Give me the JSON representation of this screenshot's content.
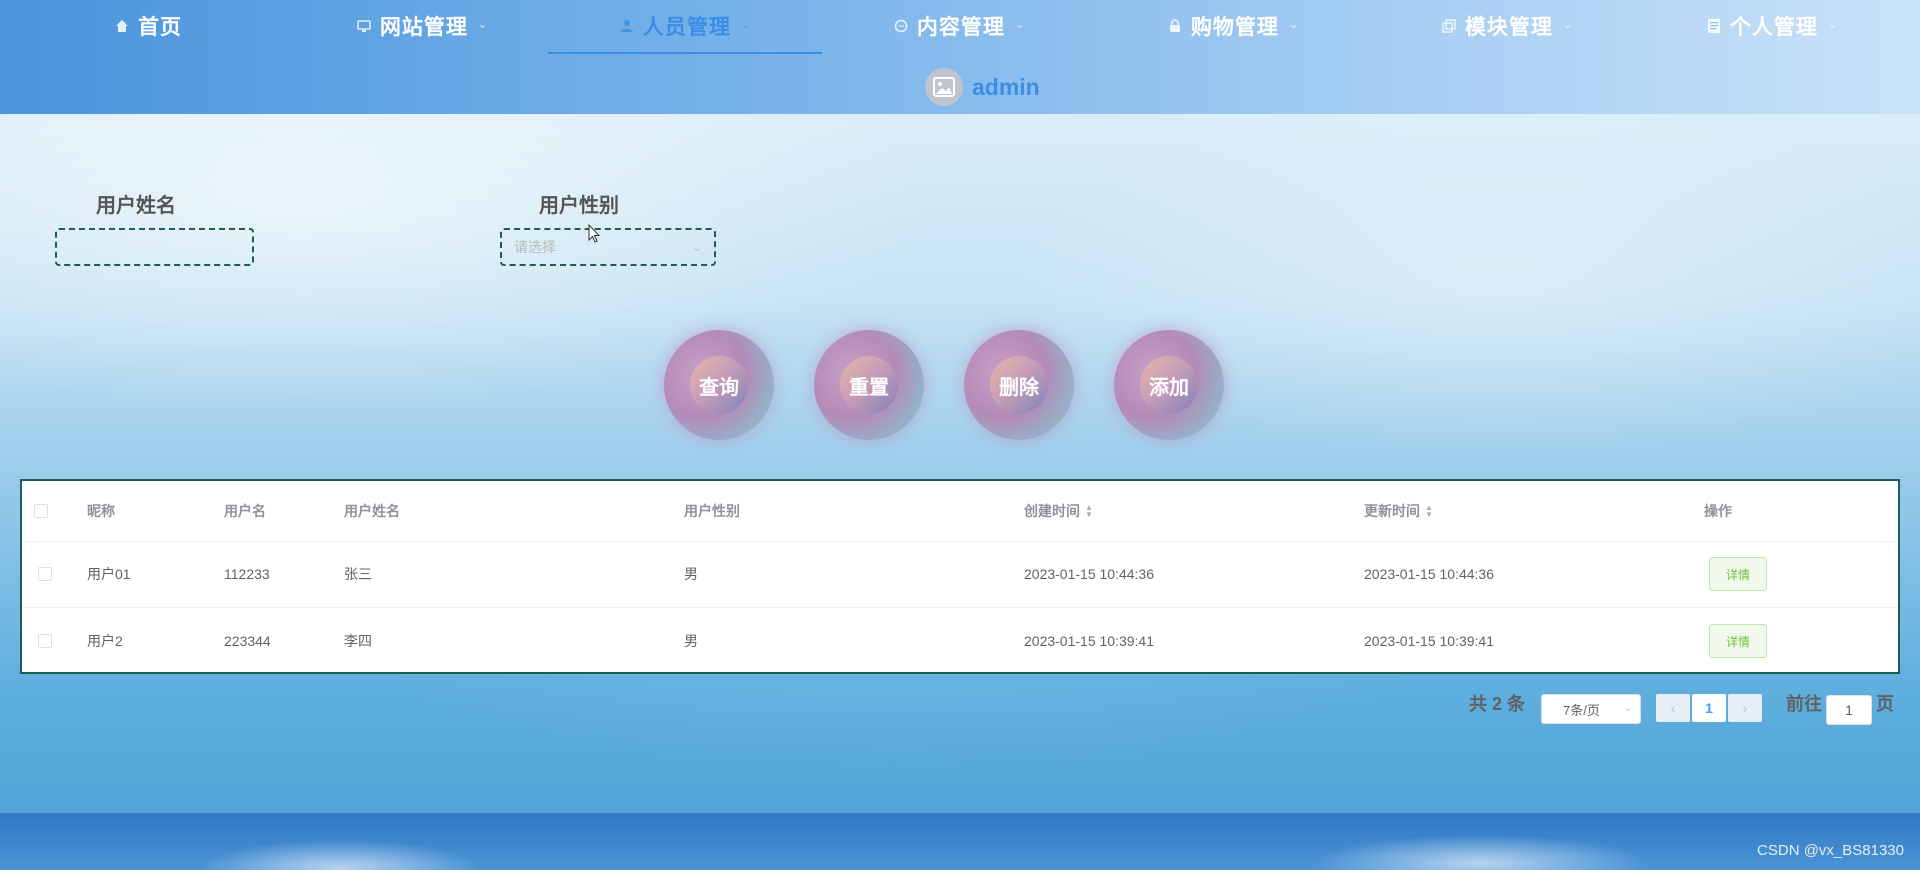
{
  "nav": {
    "items": [
      {
        "label": "首页",
        "icon": "home-icon",
        "active": false,
        "dropdown": false
      },
      {
        "label": "网站管理",
        "icon": "monitor-icon",
        "active": false,
        "dropdown": true
      },
      {
        "label": "人员管理",
        "icon": "user-icon",
        "active": true,
        "dropdown": true
      },
      {
        "label": "内容管理",
        "icon": "chat-icon",
        "active": false,
        "dropdown": true
      },
      {
        "label": "购物管理",
        "icon": "lock-icon",
        "active": false,
        "dropdown": true
      },
      {
        "label": "模块管理",
        "icon": "copy-icon",
        "active": false,
        "dropdown": true
      },
      {
        "label": "个人管理",
        "icon": "document-icon",
        "active": false,
        "dropdown": true
      }
    ],
    "username": "admin"
  },
  "search": {
    "name_label": "用户姓名",
    "name_value": "",
    "gender_label": "用户性别",
    "gender_placeholder": "请选择"
  },
  "actions": {
    "query": "查询",
    "reset": "重置",
    "delete": "删除",
    "add": "添加"
  },
  "table": {
    "columns": [
      "昵称",
      "用户名",
      "用户姓名",
      "用户性别",
      "创建时间",
      "更新时间",
      "操作"
    ],
    "rows": [
      {
        "nickname": "用户01",
        "username": "112233",
        "realname": "张三",
        "gender": "男",
        "created": "2023-01-15 10:44:36",
        "updated": "2023-01-15 10:44:36",
        "action": "详情"
      },
      {
        "nickname": "用户2",
        "username": "223344",
        "realname": "李四",
        "gender": "男",
        "created": "2023-01-15 10:39:41",
        "updated": "2023-01-15 10:39:41",
        "action": "详情"
      }
    ]
  },
  "pagination": {
    "total_text": "共 2 条",
    "page_size": "7条/页",
    "current_page": "1",
    "goto_prefix": "前往",
    "goto_value": "1",
    "goto_suffix": "页"
  },
  "colors": {
    "accent": "#3a8ee6",
    "table_border": "#1e5e52",
    "success": "#67c23a"
  },
  "watermark": "CSDN @vx_BS81330"
}
